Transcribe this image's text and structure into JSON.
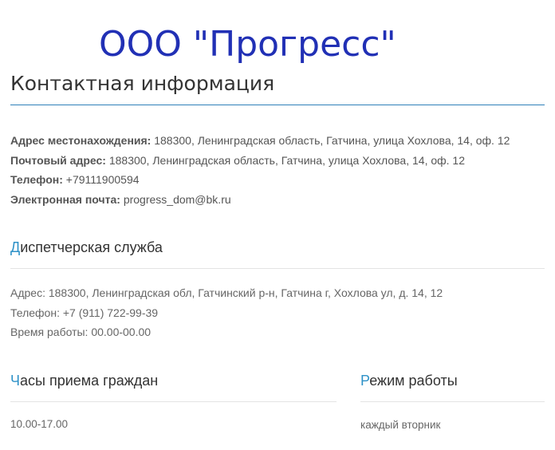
{
  "company": {
    "name": "ООО \"Прогресс\""
  },
  "contact_section": {
    "title": "Контактная информация",
    "address": {
      "label": "Адрес местонахождения:",
      "value": "188300, Ленинградская область, Гатчина, улица Хохлова, 14, оф. 12"
    },
    "postal": {
      "label": "Почтовый адрес:",
      "value": "188300, Ленинградская область, Гатчина, улица Хохлова, 14, оф. 12"
    },
    "phone": {
      "label": "Телефон:",
      "value": "+79111900594"
    },
    "email": {
      "label": "Электронная почта:",
      "value": "progress_dom@bk.ru"
    }
  },
  "dispatch_section": {
    "title_first": "Д",
    "title_rest": "испетчерская служба",
    "lines": [
      "Адрес: 188300, Ленинградская обл, Гатчинский р-н, Гатчина г, Хохлова ул, д. 14, 12",
      "Телефон: +7 (911) 722-99-39",
      "Время работы: 00.00-00.00"
    ]
  },
  "reception_section": {
    "title_first": "Ч",
    "title_rest": "асы приема граждан",
    "value": "10.00-17.00"
  },
  "schedule_section": {
    "title_first": "Р",
    "title_rest": "ежим работы",
    "value": "каждый вторник"
  },
  "colors": {
    "company_title": "#2130b5",
    "accent": "#2f92c8",
    "heading_rule": "#2f80b8",
    "divider": "#e3e3e3"
  }
}
